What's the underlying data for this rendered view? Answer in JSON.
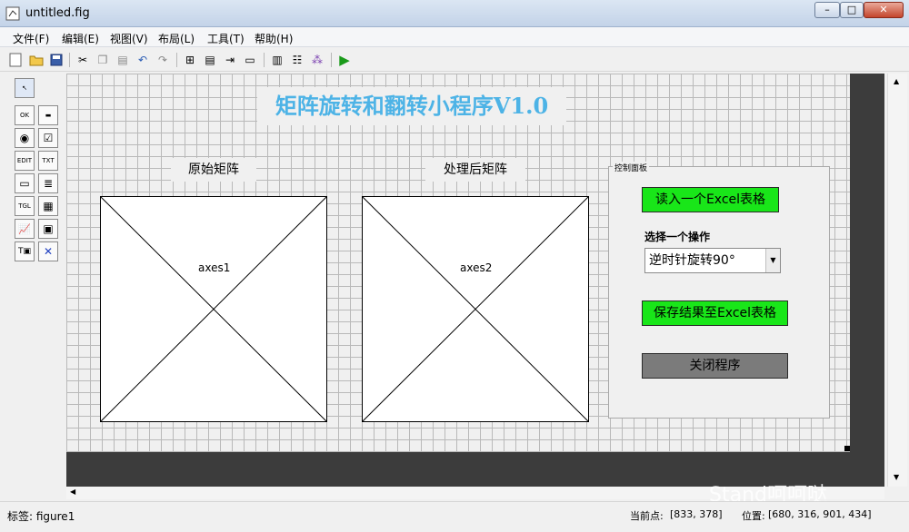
{
  "window": {
    "title": "untitled.fig"
  },
  "menu": [
    "文件(F)",
    "编辑(E)",
    "视图(V)",
    "布局(L)",
    "工具(T)",
    "帮助(H)"
  ],
  "toolbar_icons": [
    "new-icon",
    "open-icon",
    "save-icon",
    "cut-icon",
    "copy-icon",
    "paste-icon",
    "undo-icon",
    "redo-icon",
    "align-icon",
    "menu-editor-icon",
    "tab-order-icon",
    "toolbar-editor-icon",
    "mfile-editor-icon",
    "property-inspector-icon",
    "object-browser-icon",
    "run-icon"
  ],
  "palette": [
    {
      "name": "select-tool",
      "glyph": "↖"
    },
    {
      "name": "push-button-tool",
      "glyph": "OK"
    },
    {
      "name": "slider-tool",
      "glyph": "▬"
    },
    {
      "name": "radio-button-tool",
      "glyph": "◉"
    },
    {
      "name": "checkbox-tool",
      "glyph": "☑"
    },
    {
      "name": "edit-text-tool",
      "glyph": "EDIT"
    },
    {
      "name": "static-text-tool",
      "glyph": "TXT"
    },
    {
      "name": "popup-menu-tool",
      "glyph": "▭"
    },
    {
      "name": "listbox-tool",
      "glyph": "≣"
    },
    {
      "name": "toggle-button-tool",
      "glyph": "TGL"
    },
    {
      "name": "table-tool",
      "glyph": "▦"
    },
    {
      "name": "axes-tool",
      "glyph": "📈"
    },
    {
      "name": "panel-tool",
      "glyph": "▣"
    },
    {
      "name": "button-group-tool",
      "glyph": "T▣"
    },
    {
      "name": "activex-tool",
      "glyph": "✕"
    }
  ],
  "figure": {
    "title": "矩阵旋转和翻转小程序V1.0",
    "axes_left": {
      "label": "原始矩阵",
      "name": "axes1"
    },
    "axes_right": {
      "label": "处理后矩阵",
      "name": "axes2"
    },
    "panel": {
      "title": "控制面板",
      "read_button": "读入一个Excel表格",
      "op_label": "选择一个操作",
      "op_value": "逆时针旋转90°",
      "save_button": "保存结果至Excel表格",
      "close_button": "关闭程序"
    }
  },
  "status": {
    "label": "标签: figure1",
    "current_point_label": "当前点:",
    "current_point_value": "[833, 378]",
    "position_label": "位置:",
    "position_value": "[680, 316, 901, 434]"
  },
  "watermark": "Stand呵呵哒",
  "colors": {
    "title": "#4db3e6",
    "green_button": "#19e619",
    "gray_button": "#7b7b7b"
  }
}
